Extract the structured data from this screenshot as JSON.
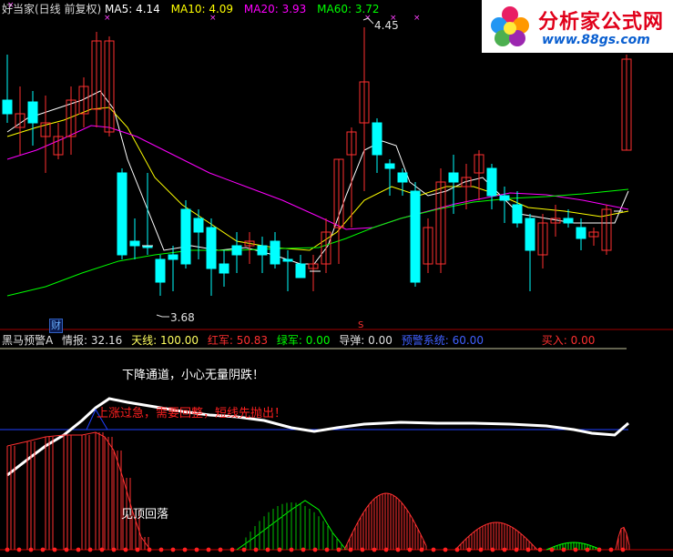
{
  "top_header": {
    "title": "好当家(日线 前复权)",
    "ma5_label": "MA5:",
    "ma5_value": "4.14",
    "ma10_label": "MA10:",
    "ma10_value": "4.09",
    "ma20_label": "MA20:",
    "ma20_value": "3.93",
    "ma60_label": "MA60:",
    "ma60_value": "3.72"
  },
  "logo": {
    "main": "分析家公式网",
    "url": "www.88gs.com"
  },
  "price_annotations": {
    "high": "4.45",
    "low": "3.68",
    "cai_tag": "财",
    "s_tag": "S"
  },
  "indicator_header": {
    "name": "黑马预警A",
    "qingbao_label": "情报:",
    "qingbao_value": "32.16",
    "tianxian_label": "天线:",
    "tianxian_value": "100.00",
    "hongjun_label": "红军:",
    "hongjun_value": "50.83",
    "lvjun_label": "绿军:",
    "lvjun_value": "0.00",
    "daodan_label": "导弹:",
    "daodan_value": "0.00",
    "yujing_label": "预警系统:",
    "yujing_value": "60.00",
    "mairu_label": "买入:",
    "mairu_value": "0.00"
  },
  "notes": {
    "downtrend": "下降通道，小心无量阴跌！",
    "overheat": "上涨过急，需要回整，短线先抛出！",
    "top_fall": "见顶回落"
  },
  "colors": {
    "background": "#000000",
    "up_candle": "#ff3030",
    "down_candle": "#00ffff",
    "ma5": "#ffffff",
    "ma10": "#ffff00",
    "ma20": "#ff00ff",
    "ma60": "#00ff00",
    "axis": "#c00000"
  }
}
